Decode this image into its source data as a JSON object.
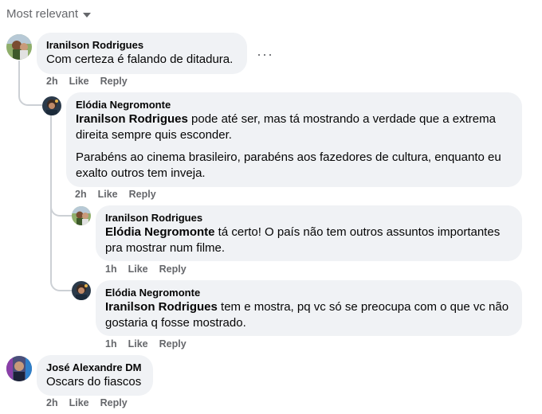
{
  "sort": {
    "label": "Most relevant"
  },
  "more_label": "···",
  "comments": [
    {
      "author": "Iranilson Rodrigues",
      "mention": "",
      "paragraphs": [
        "Com certeza é falando de ditadura."
      ],
      "time": "2h",
      "like": "Like",
      "reply": "Reply"
    },
    {
      "author": "Elódia Negromonte",
      "mention": "Iranilson Rodrigues",
      "paragraphs": [
        " pode até ser, mas tá mostrando a verdade que a extrema direita sempre quis esconder.",
        "Parabéns ao cinema brasileiro, parabéns aos fazedores de cultura, enquanto eu exalto outros tem inveja."
      ],
      "time": "2h",
      "like": "Like",
      "reply": "Reply"
    },
    {
      "author": "Iranilson Rodrigues",
      "mention": "Elódia Negromonte",
      "paragraphs": [
        " tá certo! O país não tem outros assuntos importantes pra mostrar num filme."
      ],
      "time": "1h",
      "like": "Like",
      "reply": "Reply"
    },
    {
      "author": "Elódia Negromonte",
      "mention": "Iranilson Rodrigues",
      "paragraphs": [
        " tem e mostra, pq vc só se preocupa com o que vc não gostaria q fosse mostrado."
      ],
      "time": "1h",
      "like": "Like",
      "reply": "Reply"
    },
    {
      "author": "José Alexandre DM",
      "mention": "",
      "paragraphs": [
        "Oscars do fiascos"
      ],
      "time": "2h",
      "like": "Like",
      "reply": "Reply"
    }
  ]
}
